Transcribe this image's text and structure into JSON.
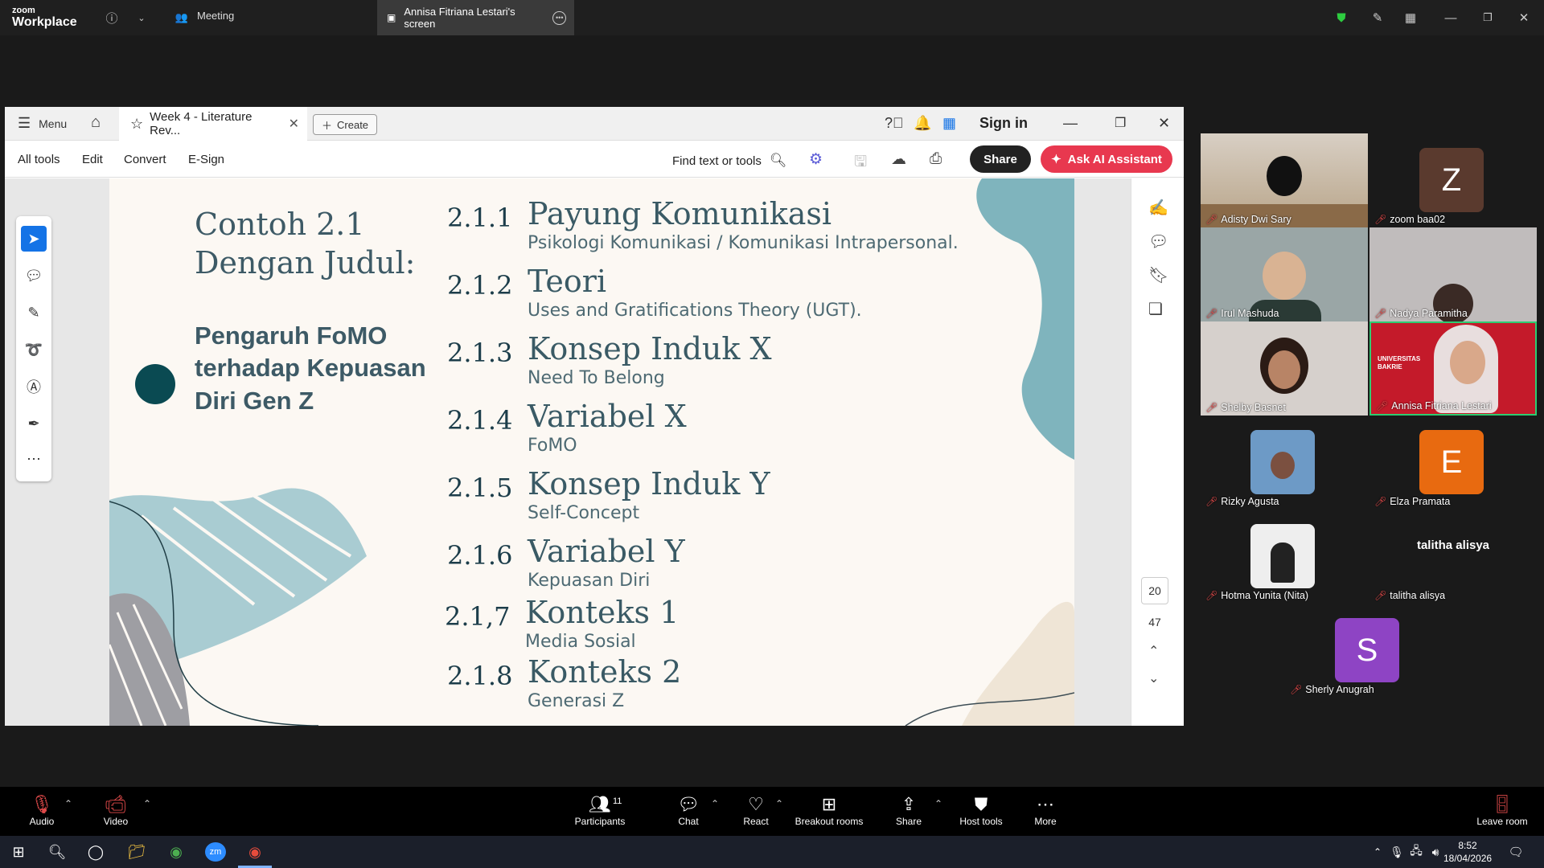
{
  "zoom": {
    "logo_line1": "zoom",
    "logo_line2": "Workplace",
    "meeting_tab": "Meeting",
    "screen_tab": "Annisa Fitriana Lestari's screen"
  },
  "acrobat": {
    "menu_label": "Menu",
    "doc_tab": "Week 4 - Literature Rev...",
    "create_label": "Create",
    "sign_in": "Sign in",
    "toolbar": {
      "all_tools": "All tools",
      "edit": "Edit",
      "convert": "Convert",
      "esign": "E-Sign",
      "find": "Find text or tools",
      "share": "Share",
      "ai_assistant": "Ask AI Assistant"
    },
    "page_current": "20",
    "page_total": "47"
  },
  "slide": {
    "title_line1": "Contoh 2.1",
    "title_line2": "Dengan Judul:",
    "subject": "Pengaruh FoMO terhadap Kepuasan Diri Gen Z",
    "sections": [
      {
        "num": "2.1.1",
        "title": "Payung Komunikasi",
        "desc": "Psikologi Komunikasi / Komunikasi Intrapersonal."
      },
      {
        "num": "2.1.2",
        "title": "Teori",
        "desc": "Uses and Gratifications Theory (UGT)."
      },
      {
        "num": "2.1.3",
        "title": "Konsep Induk X",
        "desc": "Need To Belong"
      },
      {
        "num": "2.1.4",
        "title": "Variabel X",
        "desc": "FoMO"
      },
      {
        "num": "2.1.5",
        "title": "Konsep Induk Y",
        "desc": "Self-Concept"
      },
      {
        "num": "2.1.6",
        "title": "Variabel Y",
        "desc": "Kepuasan Diri"
      },
      {
        "num": "2.1,7",
        "title": "Konteks 1",
        "desc": "Media Sosial"
      },
      {
        "num": "2.1.8",
        "title": "Konteks 2",
        "desc": "Generasi Z"
      }
    ]
  },
  "participants": {
    "count": "11",
    "tiles": [
      {
        "name": "Adisty Dwi Sary"
      },
      {
        "name": "zoom baa02",
        "initial": "Z"
      },
      {
        "name": "Irul Mashuda"
      },
      {
        "name": "Nadya Paramitha"
      },
      {
        "name": "Shelby Basnet"
      },
      {
        "name": "Annisa Fitriana Lestari",
        "banner1": "UNIVERSITAS",
        "banner2": "BAKRIE"
      },
      {
        "name": "Rizky Agusta"
      },
      {
        "name": "Elza Pramata",
        "initial": "E"
      },
      {
        "name": "Hotma Yunita (Nita)"
      },
      {
        "name": "talitha alisya",
        "center": "talitha alisya"
      },
      {
        "name": "Sherly Anugrah",
        "initial": "S"
      }
    ]
  },
  "bottom_bar": {
    "audio": "Audio",
    "video": "Video",
    "participants": "Participants",
    "chat": "Chat",
    "react": "React",
    "breakout": "Breakout rooms",
    "share": "Share",
    "host_tools": "Host tools",
    "more": "More",
    "leave": "Leave room"
  },
  "taskbar": {
    "time": "8:52",
    "date": "18/04/2026"
  },
  "colors": {
    "ai_button": "#e8384f",
    "active_tool": "#1473e6",
    "slide_accent": "#0a4a52",
    "teal_deco": "#7fb4bd"
  }
}
